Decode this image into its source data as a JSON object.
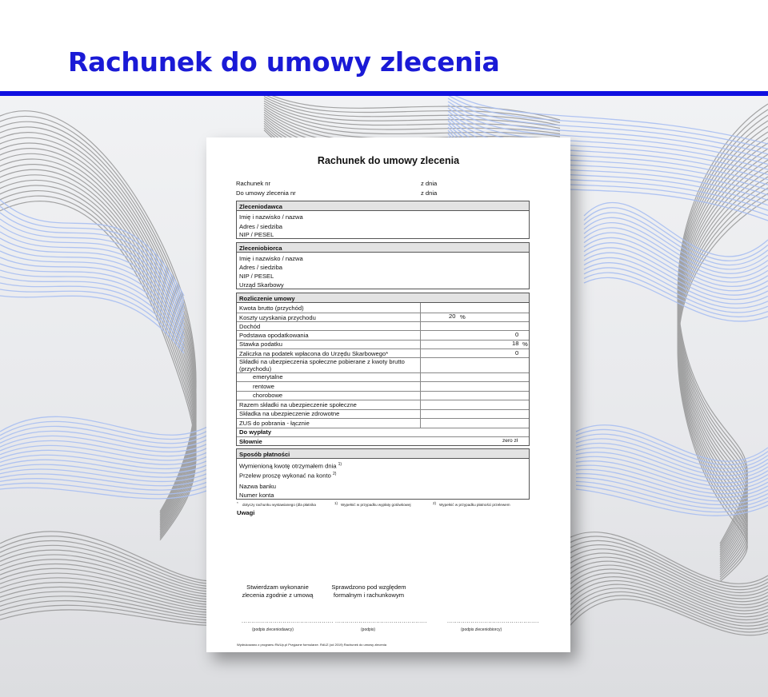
{
  "page_title": "Rachunek do umowy zlecenia",
  "colors": {
    "accent": "#1a1ad6",
    "rule": "#1010e0"
  },
  "document": {
    "title": "Rachunek do umowy zlecenia",
    "rachunek_nr": "Rachunek nr",
    "umowa_nr": "Do umowy zlecenia nr",
    "z_dnia_1": "z dnia",
    "z_dnia_2": "z dnia",
    "zleceniodawca": {
      "heading": "Zleceniodawca",
      "rows": [
        "Imię i nazwisko / nazwa",
        "Adres / siedziba",
        "NIP / PESEL"
      ]
    },
    "zleceniobiorca": {
      "heading": "Zleceniobiorca",
      "rows": [
        "Imię i nazwisko / nazwa",
        "Adres / siedziba",
        "NIP / PESEL",
        "Urząd Skarbowy"
      ]
    },
    "rozliczenie": {
      "heading": "Rozliczenie umowy",
      "kwota_brutto": "Kwota brutto (przychód)",
      "koszty": "Koszty uzyskania przychodu",
      "koszty_value": "20",
      "koszty_unit": "%",
      "dochod": "Dochód",
      "podstawa": "Podstawa opodatkowania",
      "podstawa_value": "0",
      "stawka": "Stawka podatku",
      "stawka_value": "18",
      "stawka_unit": "%",
      "zaliczka": "Zaliczka na podatek wpłacona do Urzędu Skarbowego*",
      "zaliczka_value": "0",
      "skladki_line1": "Składki na ubezpieczenia społeczne pobierane z kwoty brutto",
      "skladki_line2": "(przychodu)",
      "emerytalne": "emerytalne",
      "rentowe": "rentowe",
      "chorobowe": "chorobowe",
      "razem": "Razem składki na ubezpieczenie społeczne",
      "zdrowotne": "Składka na ubezpieczenie zdrowotne",
      "zus": "ZUS do pobrania - łącznie",
      "do_wyplaty": "Do wypłaty",
      "slownie": "Słownie",
      "slownie_value": "zero zł"
    },
    "platnosc": {
      "heading": "Sposób płatności",
      "row1": "Wymienioną kwotę otrzymałem dnia",
      "row1_sup": "1)",
      "row2": "Przelew proszę wykonać na konto",
      "row2_sup": "2)",
      "row3": "Nazwa banku",
      "row4": "Numer konta"
    },
    "footnotes": {
      "f1_mark": "*",
      "f1": "dotyczy rachunku wystawianego (dla płatnika",
      "f2_mark": "1)",
      "f2": "Wypełnić w przypadku wypłaty gotówkowej",
      "f3_mark": "2)",
      "f3": "Wypełnić w przypadku płatności przelewem"
    },
    "uwagi": "Uwagi",
    "stwierdzam_1": "Stwierdzam wykonanie",
    "stwierdzam_2": "zlecenia zgodnie z umową",
    "sprawdzono_1": "Sprawdzono pod względem",
    "sprawdzono_2": "formalnym i rachunkowym",
    "dots": "...............................................",
    "podpis_zleceniodawcy": "(podpis zleceniodawcy)",
    "podpis": "(podpis)",
    "podpis_zleceniobiorcy": "(podpis zleceniobiorcy)",
    "footer": "Wydrukowano z programu Rk/Up.pl Przyjazne formularze.  RdUZ (od 2019) Rachunek do umowy zlecenia"
  }
}
